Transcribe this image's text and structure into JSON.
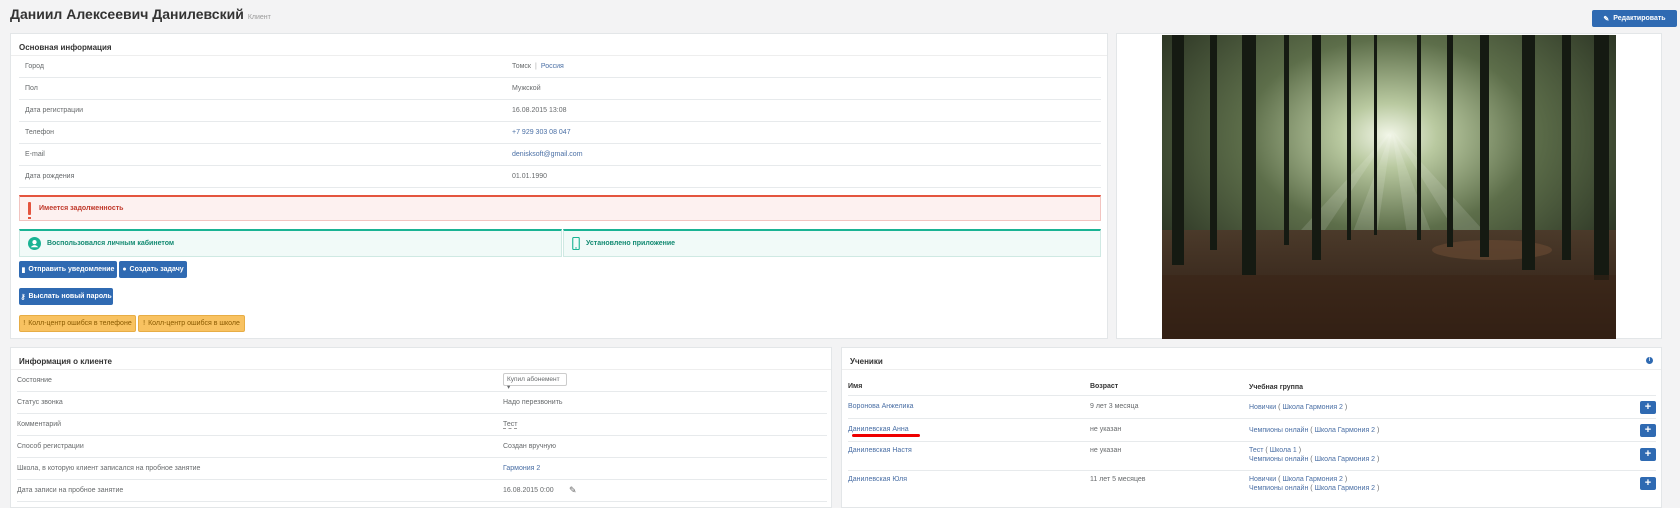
{
  "header": {
    "name": "Даниил Алексеевич Данилевский",
    "role": "Клиент",
    "edit_label": "Редактировать"
  },
  "main_info": {
    "title": "Основная информация",
    "rows": [
      {
        "label": "Город",
        "value": "Томск",
        "value2": "Россия"
      },
      {
        "label": "Пол",
        "value": "Мужской"
      },
      {
        "label": "Дата регистрации",
        "value": "16.08.2015 13:08"
      },
      {
        "label": "Телефон",
        "value": "+7 929 303 08 047"
      },
      {
        "label": "E-mail",
        "value": "denisksoft@gmail.com"
      },
      {
        "label": "Дата рождения",
        "value": "01.01.1990"
      }
    ],
    "debt_alert": "Имеется задолженность",
    "cabinet_status": "Воспользовался личным кабинетом",
    "app_status": "Установлено приложение",
    "buttons": {
      "send_notification": "Отправить уведомление",
      "create_task": "Создать задачу",
      "send_password": "Выслать новый пароль",
      "callcenter_phone": "Колл-центр ошибся в телефоне",
      "callcenter_school": "Колл-центр ошибся в школе"
    }
  },
  "client_info": {
    "title": "Информация о клиенте",
    "rows": [
      {
        "label": "Состояние",
        "value": "Купил абонемент"
      },
      {
        "label": "Статус звонка",
        "value": "Надо перезвонить"
      },
      {
        "label": "Комментарий",
        "value": "Тест"
      },
      {
        "label": "Способ регистрации",
        "value": "Создан вручную"
      },
      {
        "label": "Школа, в которую клиент записался на пробное занятие",
        "value": "Гармония 2"
      },
      {
        "label": "Дата записи на пробное занятие",
        "value": "16.08.2015 0:00"
      }
    ]
  },
  "students": {
    "title": "Ученики",
    "columns": [
      "Имя",
      "Возраст",
      "Учебная группа"
    ],
    "rows": [
      {
        "name": "Воронова Анжелика",
        "age": "9 лет 3 месяца",
        "groups": [
          {
            "group": "Новички",
            "school": "Школа Гармония 2"
          }
        ]
      },
      {
        "name": "Данилевская Анна",
        "age": "не указан",
        "groups": [
          {
            "group": "Чемпионы онлайн",
            "school": "Школа Гармония 2"
          }
        ]
      },
      {
        "name": "Данилевская Настя",
        "age": "не указан",
        "groups": [
          {
            "group": "Тест",
            "school": "Школа 1"
          },
          {
            "group": "Чемпионы онлайн",
            "school": "Школа Гармония 2"
          }
        ]
      },
      {
        "name": "Данилевская Юля",
        "age": "11 лет 5 месяцев",
        "groups": [
          {
            "group": "Новички",
            "school": "Школа Гармония 2"
          },
          {
            "group": "Чемпионы онлайн",
            "school": "Школа Гармония 2"
          }
        ]
      }
    ]
  },
  "colors": {
    "primary": "#2f6ab2",
    "danger": "#e4553f",
    "success": "#1ab394",
    "warning": "#f8c261"
  }
}
